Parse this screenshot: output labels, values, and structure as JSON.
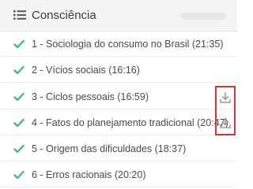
{
  "header": {
    "title": "Consciência",
    "icon": "list-icon"
  },
  "lessons": [
    {
      "label": "1 - Sociologia do consumo no Brasil (21:35)",
      "completed": true,
      "download": false
    },
    {
      "label": "2 - Vícios sociais (16:16)",
      "completed": true,
      "download": false
    },
    {
      "label": "3 - Ciclos pessoais (16:59)",
      "completed": true,
      "download": true
    },
    {
      "label": "4 - Fatos do planejamento tradicional (20:47)",
      "completed": true,
      "download": true
    },
    {
      "label": "5 - Origem das dificuldades (18:37)",
      "completed": true,
      "download": false
    },
    {
      "label": "6 - Erros racionais (20:20)",
      "completed": true,
      "download": false
    }
  ],
  "colors": {
    "check": "#3dbb7a",
    "download_icon": "#9a9a9a",
    "highlight": "#d9343b",
    "header_bg": "#f4f4f4"
  }
}
